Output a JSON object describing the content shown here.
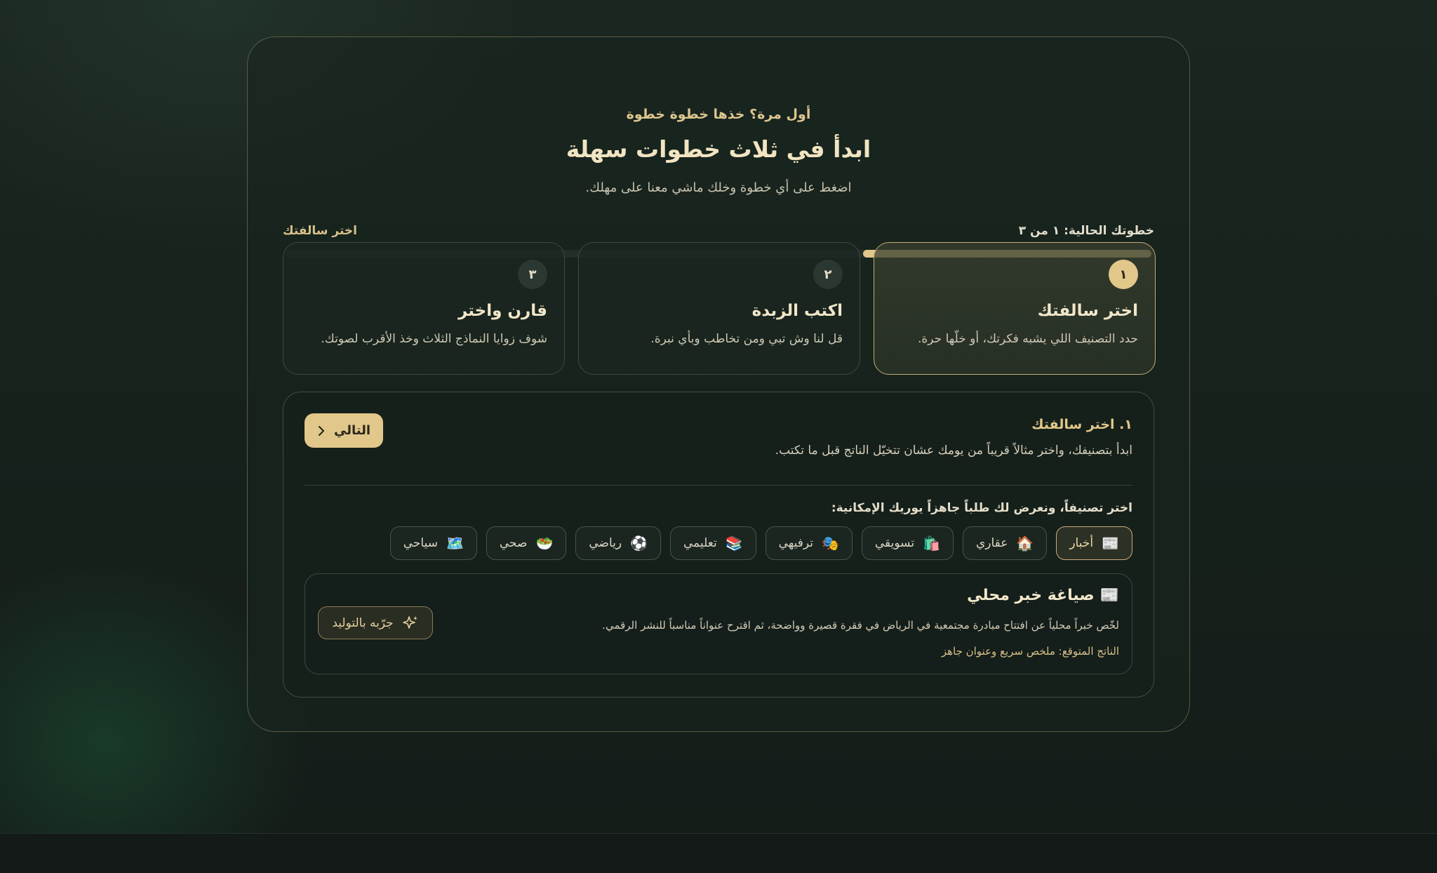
{
  "header": {
    "eyebrow": "أول مرة؟ خذها خطوة خطوة",
    "title": "ابدأ في ثلاث خطوات سهلة",
    "subtitle": "اضغط على أي خطوة وخلك ماشي معنا على مهلك."
  },
  "progress": {
    "current_label": "خطوتك الحالية: ١ من ٣",
    "step_name": "اختر سالفتك",
    "fraction": 0.333
  },
  "steps": [
    {
      "number": "١",
      "title": "اختر سالفتك",
      "desc": "حدد التصنيف اللي يشبه فكرتك، أو خلّها حرة.",
      "active": true
    },
    {
      "number": "٢",
      "title": "اكتب الزبدة",
      "desc": "قل لنا وش تبي ومن تخاطب وبأي نبرة.",
      "active": false
    },
    {
      "number": "٣",
      "title": "قارن واختر",
      "desc": "شوف زوايا النماذج الثلاث وخذ الأقرب لصوتك.",
      "active": false
    }
  ],
  "content": {
    "title": "١. اختر سالفتك",
    "desc": "ابدأ بتصنيفك، واختر مثالاً قريباً من يومك عشان تتخيّل الناتج قبل ما تكتب.",
    "next_label": "التالي",
    "pick_label": "اختر تصنيفاً، ونعرض لك طلباً جاهزاً يوريك الإمكانية:",
    "categories": [
      {
        "icon": "📰",
        "label": "أخبار",
        "active": true
      },
      {
        "icon": "🏠",
        "label": "عقاري",
        "active": false
      },
      {
        "icon": "🛍️",
        "label": "تسويقي",
        "active": false
      },
      {
        "icon": "🎭",
        "label": "ترفيهي",
        "active": false
      },
      {
        "icon": "📚",
        "label": "تعليمي",
        "active": false
      },
      {
        "icon": "⚽",
        "label": "رياضي",
        "active": false
      },
      {
        "icon": "🥗",
        "label": "صحي",
        "active": false
      },
      {
        "icon": "🗺️",
        "label": "سياحي",
        "active": false
      }
    ],
    "example": {
      "icon": "📰",
      "title": "صياغة خبر محلي",
      "desc": "لخّص خبراً محلياً عن افتتاح مبادرة مجتمعية في الرياض في فقرة قصيرة وواضحة، ثم اقترح عنواناً مناسباً للنشر الرقمي.",
      "output": "الناتج المتوقع: ملخص سريع وعنوان جاهز",
      "try_label": "جرّبه بالتوليد"
    }
  }
}
